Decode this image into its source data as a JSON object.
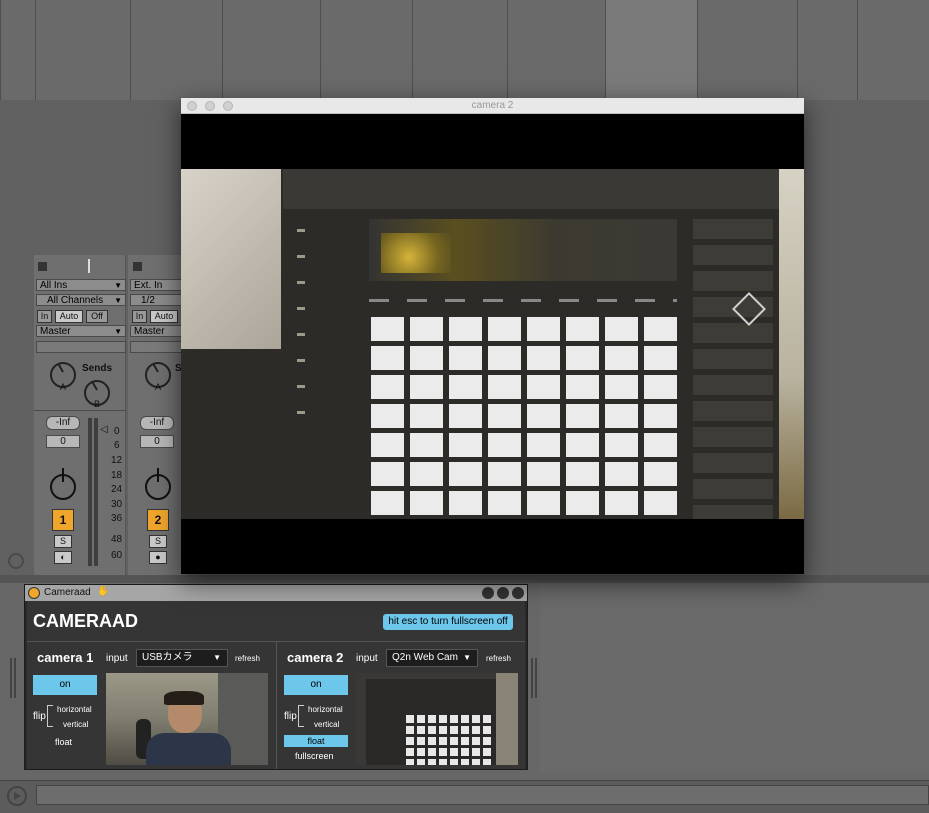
{
  "camera_window": {
    "title": "camera 2"
  },
  "mixer": {
    "tracks": [
      {
        "input_type": "All Ins",
        "input_channel": "All Channels",
        "monitor": [
          "In",
          "Auto",
          "Off"
        ],
        "output": "Master",
        "sends_label": "Sends",
        "send_a": "A",
        "send_b": "B",
        "peak": "-Inf",
        "volume": "0",
        "number": "1",
        "solo": "S"
      },
      {
        "input_type": "Ext. In",
        "input_channel": "1/2",
        "monitor": [
          "In",
          "Auto"
        ],
        "output": "Master",
        "send_a": "A",
        "sends_cut": "S",
        "peak": "-Inf",
        "volume": "0",
        "number": "2",
        "solo": "S"
      }
    ],
    "meter_scale": [
      "0",
      "6",
      "12",
      "18",
      "24",
      "30",
      "36",
      "48",
      "60"
    ]
  },
  "device": {
    "name": "Cameraad",
    "hand_icon": "hand-icon",
    "title": "CAMERAAD",
    "fullscreen_hint": "hit esc to turn fullscreen off",
    "cam1": {
      "label": "camera 1",
      "input_label": "input",
      "input_value": "USBカメラ",
      "refresh": "refresh",
      "on": "on",
      "flip": "flip",
      "horizontal": "horizontal",
      "vertical": "vertical",
      "float": "float"
    },
    "cam2": {
      "label": "camera 2",
      "input_label": "input",
      "input_value": "Q2n Web Cam",
      "refresh": "refresh",
      "on": "on",
      "flip": "flip",
      "horizontal": "horizontal",
      "vertical": "vertical",
      "float": "float",
      "fullscreen": "fullscreen"
    }
  },
  "colors": {
    "accent_yellow": "#f0a52c",
    "accent_blue": "#6cc7ea",
    "daw_bg": "#616161"
  }
}
